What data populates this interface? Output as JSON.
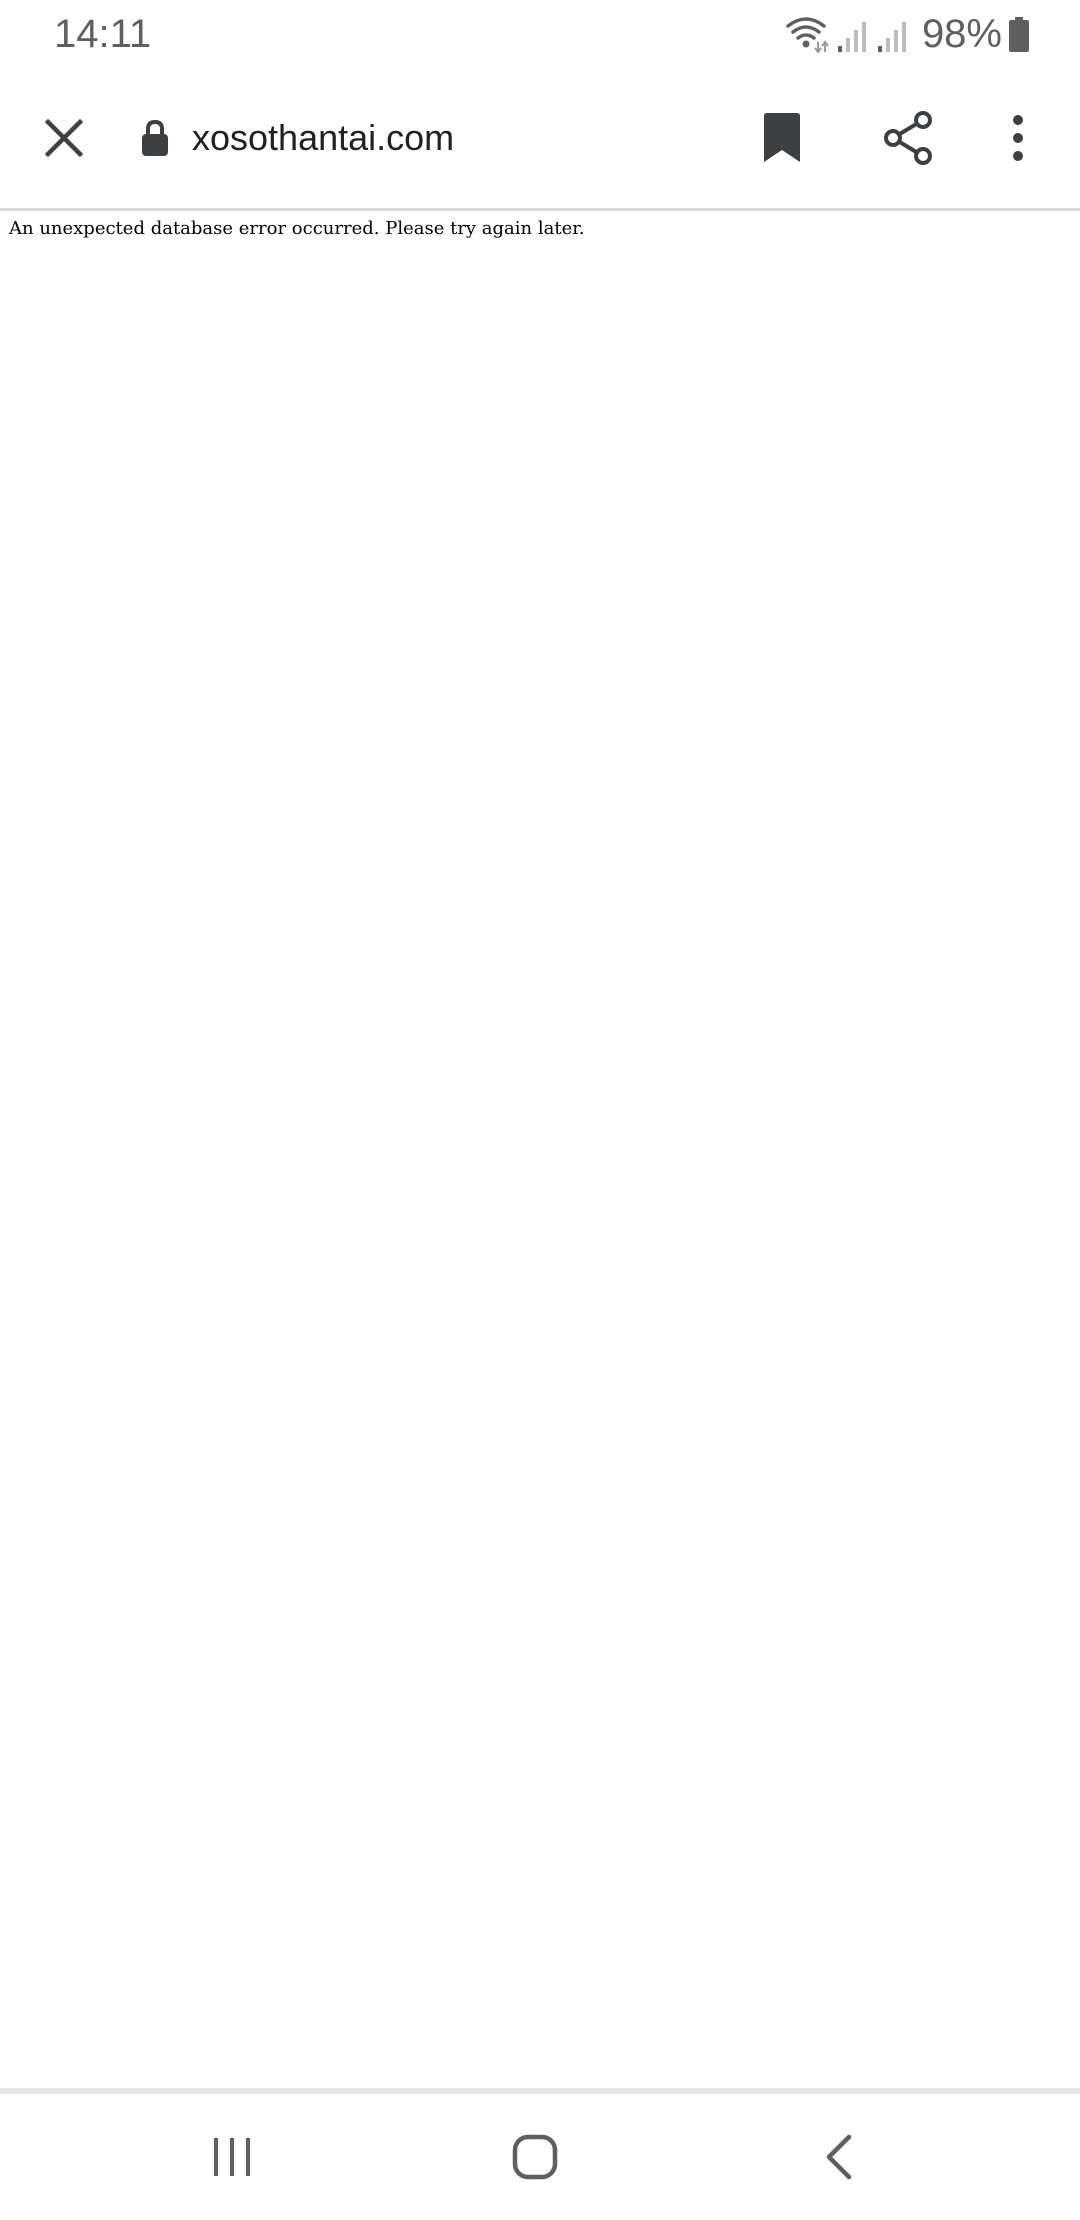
{
  "status_bar": {
    "time": "14:11",
    "battery_percent": "98%",
    "icons": [
      "wifi-icon",
      "cell-signal-icon",
      "cell-signal-icon",
      "battery-icon"
    ]
  },
  "toolbar": {
    "url": "xosothantai.com",
    "icons": [
      "close-icon",
      "lock-icon",
      "bookmark-icon",
      "share-icon",
      "more-vert-icon"
    ]
  },
  "page": {
    "error_message": "An unexpected database error occurred. Please try again later."
  },
  "nav_bar": {
    "icons": [
      "recents-icon",
      "home-icon",
      "back-icon"
    ]
  },
  "colors": {
    "icon_dark": "#3c4043",
    "status_gray": "#5f5f5f",
    "divider": "#d9d9d9",
    "background": "#ffffff"
  }
}
